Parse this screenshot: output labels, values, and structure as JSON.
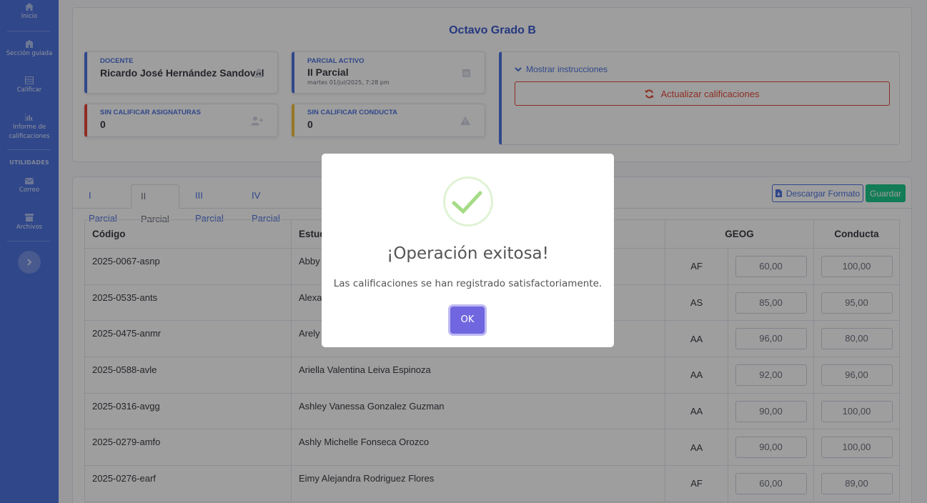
{
  "sidebar": {
    "items": [
      {
        "label": "Inicio",
        "icon": "home-icon"
      },
      {
        "label": "Sección guiada",
        "icon": "school-icon"
      },
      {
        "label": "Calificar",
        "icon": "table-icon"
      },
      {
        "label": "Informe de calificaciones",
        "icon": "chart-icon"
      }
    ],
    "utilities_heading": "UTILIDADES",
    "utilities": [
      {
        "label": "Correo",
        "icon": "mail-icon"
      },
      {
        "label": "Archivos",
        "icon": "archive-icon"
      }
    ]
  },
  "header": {
    "title": "Octavo Grado B"
  },
  "stats": {
    "teacher": {
      "label": "DOCENTE",
      "value": "Ricardo José Hernández Sandoval",
      "color": "#4e73df"
    },
    "partial": {
      "label": "PARCIAL ACTIVO",
      "value": "II Parcial",
      "sub": "martes 01/jul/2025, 7:28 pm",
      "color": "#4e73df"
    },
    "ungraded_subjects": {
      "label": "SIN CALIFICAR ASIGNATURAS",
      "value": "0",
      "color": "#e74a3b"
    },
    "ungraded_conduct": {
      "label": "SIN CALIFICAR CONDUCTA",
      "value": "0",
      "color": "#f6c23e"
    }
  },
  "instructions": {
    "toggle_label": "Mostrar instrucciones",
    "refresh_label": "Actualizar calificaciones"
  },
  "tabs": [
    "I Parcial",
    "II Parcial",
    "III Parcial",
    "IV Parcial"
  ],
  "active_tab": "II Parcial",
  "toolbar": {
    "download_label": "Descargar Formato",
    "save_label": "Guardar"
  },
  "table": {
    "headers": {
      "code": "Código",
      "student": "Estud",
      "subject": "GEOG",
      "conduct": "Conducta"
    },
    "rows": [
      {
        "code": "2025-0067-asnp",
        "student": "Abby",
        "level": "AF",
        "grade": "60,00",
        "conduct": "100,00"
      },
      {
        "code": "2025-0535-ants",
        "student": "Alexa",
        "level": "AS",
        "grade": "85,00",
        "conduct": "95,00"
      },
      {
        "code": "2025-0475-anmr",
        "student": "Arely",
        "level": "AA",
        "grade": "96,00",
        "conduct": "80,00"
      },
      {
        "code": "2025-0588-avle",
        "student": "Ariella Valentina Leiva Espinoza",
        "level": "AA",
        "grade": "92,00",
        "conduct": "96,00"
      },
      {
        "code": "2025-0316-avgg",
        "student": "Ashley Vanessa Gonzalez Guzman",
        "level": "AA",
        "grade": "90,00",
        "conduct": "100,00"
      },
      {
        "code": "2025-0279-amfo",
        "student": "Ashly Michelle Fonseca Orozco",
        "level": "AA",
        "grade": "90,00",
        "conduct": "100,00"
      },
      {
        "code": "2025-0276-earf",
        "student": "Eimy Alejandra Rodriguez Flores",
        "level": "AF",
        "grade": "60,00",
        "conduct": "89,00"
      }
    ]
  },
  "modal": {
    "title": "¡Operación exitosa!",
    "message": "Las calificaciones se han registrado satisfactoriamente.",
    "ok_label": "OK",
    "icon": "success-check-icon"
  }
}
